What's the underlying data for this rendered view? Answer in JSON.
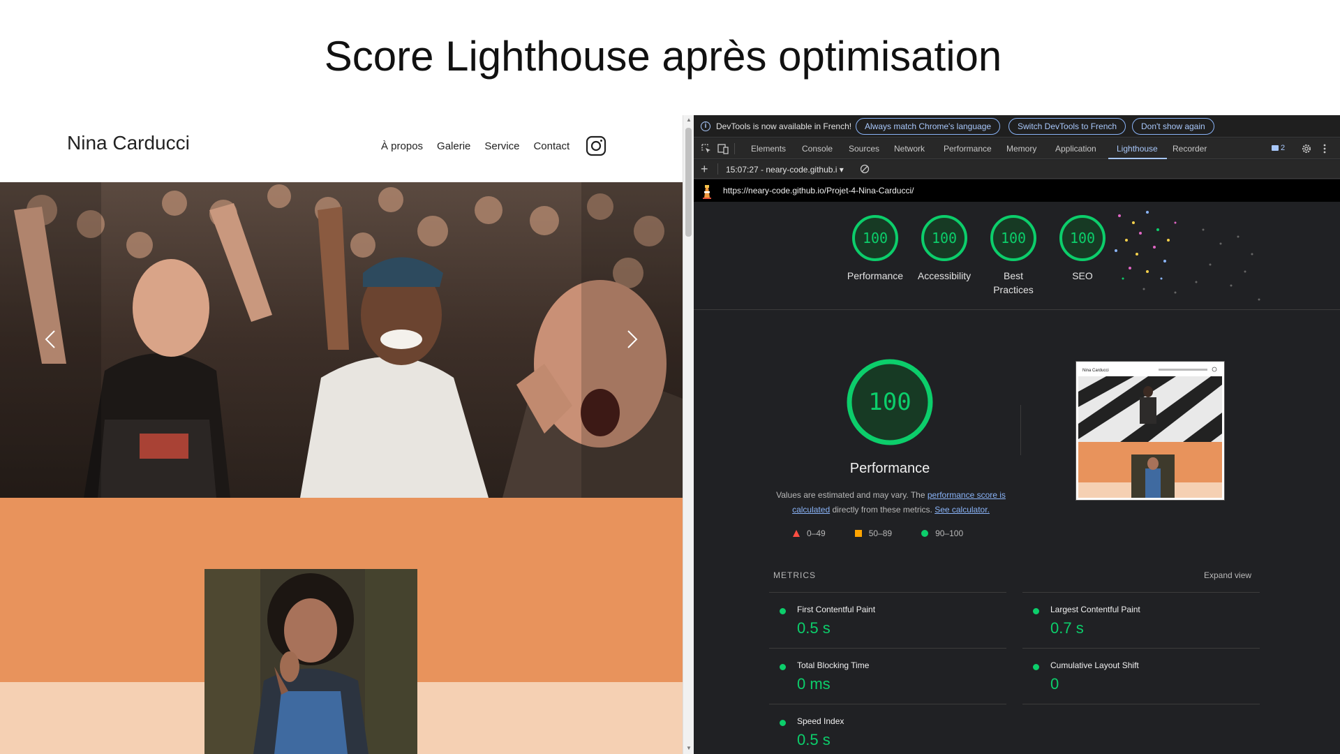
{
  "slide": {
    "title": "Score Lighthouse après optimisation"
  },
  "website": {
    "logo": "Nina Carducci",
    "nav": [
      "À propos",
      "Galerie",
      "Service",
      "Contact"
    ],
    "icons": [
      "instagram-icon",
      "chevron-left-icon",
      "chevron-right-icon"
    ],
    "carousel": {
      "active_index": 1,
      "slides": 3
    },
    "colors": {
      "accent": "#e8935c",
      "accent_light": "#f5d0b3"
    }
  },
  "devtools": {
    "infobar": {
      "text": "DevTools is now available in French!",
      "buttons": [
        "Always match Chrome's language",
        "Switch DevTools to French",
        "Don't show again"
      ]
    },
    "tabs": [
      "Elements",
      "Console",
      "Sources",
      "Network",
      "Performance",
      "Memory",
      "Application",
      "Lighthouse",
      "Recorder"
    ],
    "active_tab": "Lighthouse",
    "issues_count": "2",
    "run_select": "15:07:27 - neary-code.github.i",
    "url": "https://neary-code.github.io/Projet-4-Nina-Carducci/",
    "gauges": [
      {
        "score": "100",
        "label": "Performance"
      },
      {
        "score": "100",
        "label": "Accessibility"
      },
      {
        "score": "100",
        "label": "Best Practices"
      },
      {
        "score": "100",
        "label": "SEO"
      }
    ],
    "performance": {
      "score": "100",
      "title": "Performance",
      "desc_prefix": "Values are estimated and may vary. The",
      "link1": "performance score is calculated",
      "desc_middle": "directly from these metrics.",
      "link2": "See calculator."
    },
    "legend": [
      "0–49",
      "50–89",
      "90–100"
    ],
    "metrics_heading": "METRICS",
    "expand_view": "Expand view",
    "metrics": [
      {
        "name": "First Contentful Paint",
        "value": "0.5 s"
      },
      {
        "name": "Largest Contentful Paint",
        "value": "0.7 s"
      },
      {
        "name": "Total Blocking Time",
        "value": "0 ms"
      },
      {
        "name": "Cumulative Layout Shift",
        "value": "0"
      },
      {
        "name": "Speed Index",
        "value": "0.5 s"
      }
    ],
    "colors": {
      "pass": "#0cce6b",
      "average": "#ffa400",
      "fail": "#ff4e42",
      "link": "#8ab4f8"
    }
  }
}
